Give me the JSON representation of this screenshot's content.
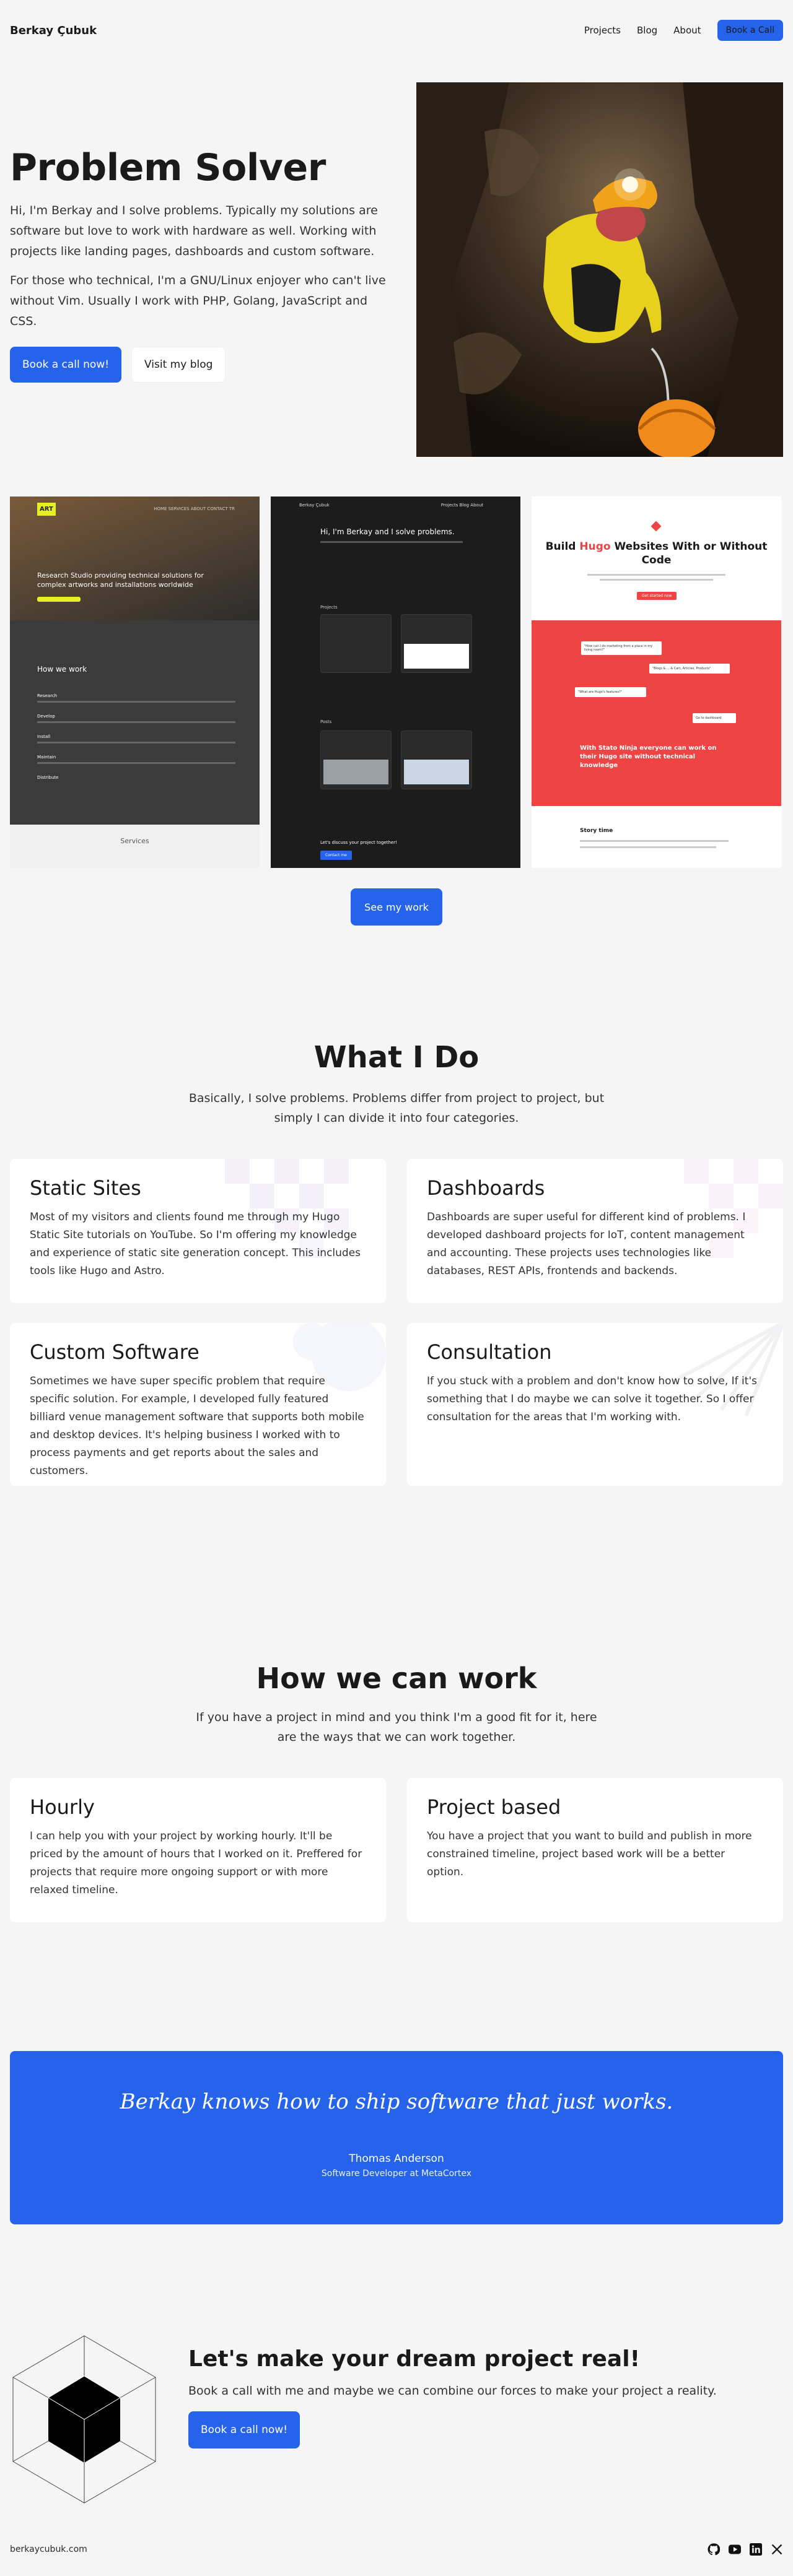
{
  "nav": {
    "brand": "Berkay Çubuk",
    "links": [
      "Projects",
      "Blog",
      "About"
    ],
    "cta": "Book a Call"
  },
  "hero": {
    "title": "Problem Solver",
    "paragraph1": "Hi, I'm Berkay and I solve problems. Typically my solutions are software but love to work with hardware as well. Working with projects like landing pages, dashboards and custom software.",
    "paragraph2": "For those who technical, I'm a GNU/Linux enjoyer who can't live without Vim. Usually I work with PHP, Golang, JavaScript and CSS.",
    "primary_button": "Book a call now!",
    "secondary_button": "Visit my blog"
  },
  "portfolio": {
    "shot1": {
      "logo": "ART",
      "nav": "HOME  SERVICES  ABOUT  CONTACT  TR",
      "heading": "Research Studio providing technical solutions for complex artworks and installations worldwide",
      "section": "How we work",
      "items": [
        "Research",
        "Develop",
        "Install",
        "Maintain",
        "Distribute"
      ],
      "footer": "Services"
    },
    "shot2": {
      "brand": "Berkay Çubuk",
      "nav": "Projects  Blog  About",
      "heading": "Hi, I'm Berkay and I solve problems.",
      "projects_label": "Projects",
      "posts_label": "Posts",
      "footer": "Let's discuss your project together!",
      "button": "Contact me"
    },
    "shot3": {
      "heading_part1": "Build",
      "heading_word": "Hugo",
      "heading_part2": "Websites With or Without Code",
      "button": "Get started now",
      "chip1": "\"How can I do marketing from a place in my living room?\"",
      "chip2": "\"Blogs & ... & Cart, Articles, Products\"",
      "chip3": "\"What are Hugo's features?\"",
      "chip4": "Go to dashboard",
      "promo": "With Stato Ninja everyone can work on their Hugo site without technical knowledge",
      "story": "Story time"
    },
    "button": "See my work"
  },
  "what_i_do": {
    "title": "What I Do",
    "subtitle": "Basically, I solve problems. Problems differ from project to project, but simply I can divide it into four categories.",
    "cards": [
      {
        "title": "Static Sites",
        "text": "Most of my visitors and clients found me through my Hugo Static Site tutorials on YouTube. So I'm offering my knowledge and experience of static site generation concept. This includes tools like Hugo and Astro."
      },
      {
        "title": "Dashboards",
        "text": "Dashboards are super useful for different kind of problems. I developed dashboard projects for IoT, content management and accounting. These projects uses technologies like databases, REST APIs, frontends and backends."
      },
      {
        "title": "Custom Software",
        "text": "Sometimes we have super specific problem that require specific solution. For example, I developed fully featured billiard venue management software that supports both mobile and desktop devices. It's helping business I worked with to process payments and get reports about the sales and customers."
      },
      {
        "title": "Consultation",
        "text": "If you stuck with a problem and don't know how to solve, If it's something that I do maybe we can solve it together. So I offer consultation for the areas that I'm working with."
      }
    ]
  },
  "how_we_work": {
    "title": "How we can work",
    "subtitle": "If you have a project in mind and you think I'm a good fit for it, here are the ways that we can work together.",
    "cards": [
      {
        "title": "Hourly",
        "text": "I can help you with your project by working hourly. It'll be priced by the amount of hours that I worked on it. Preffered for projects that require more ongoing support or with more relaxed timeline."
      },
      {
        "title": "Project based",
        "text": "You have a project that you want to build and publish in more constrained timeline, project based work will be a better option."
      }
    ]
  },
  "testimonial": {
    "quote": "Berkay knows how to ship software that just works.",
    "name": "Thomas Anderson",
    "role": "Software Developer at MetaCortex"
  },
  "cta": {
    "title": "Let's make your dream project real!",
    "subtitle": "Book a call with me and maybe we can combine our forces to make your project a reality.",
    "button": "Book a call now!"
  },
  "footer": {
    "domain": "berkaycubuk.com",
    "icons": [
      "github-icon",
      "youtube-icon",
      "linkedin-icon",
      "x-icon"
    ]
  },
  "colors": {
    "accent": "#2563eb",
    "background": "#f5f5f5",
    "promo_red": "#ef4444"
  }
}
